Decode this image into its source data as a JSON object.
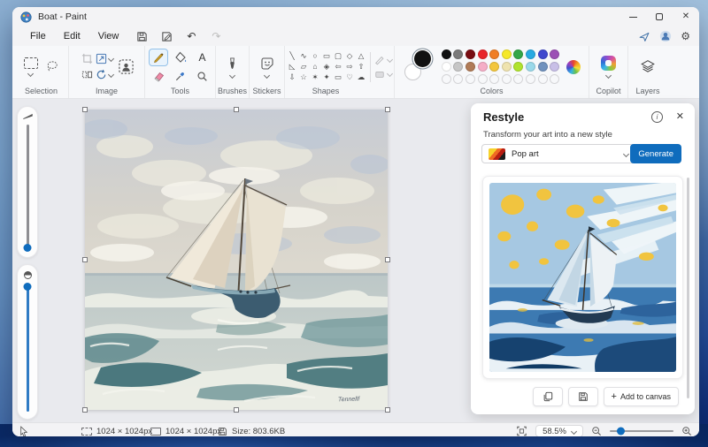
{
  "accent": "#0f6cbd",
  "window": {
    "title": "Boat - Paint"
  },
  "icons": {
    "close": "✕",
    "undo": "↶",
    "redo": "↷",
    "gear": "⚙",
    "info": "i",
    "plus": "+",
    "text_tool": "A"
  },
  "menubar": {
    "items": [
      "File",
      "Edit",
      "View"
    ]
  },
  "ribbon": {
    "groups": [
      "Selection",
      "Image",
      "Tools",
      "Brushes",
      "Stickers",
      "Shapes",
      "Colors",
      "Copilot",
      "Layers"
    ],
    "shapes": [
      "╲",
      "∿",
      "○",
      "▭",
      "▢",
      "◇",
      "△",
      "◺",
      "▱",
      "⌂",
      "◈",
      "⇦",
      "⇨",
      "⇧",
      "⇩",
      "☆",
      "✶",
      "✦",
      "▭",
      "♡",
      "☁"
    ],
    "color1": "#111111",
    "color2": "#ffffff",
    "palette_row1": [
      "#111111",
      "#7b7b7b",
      "#790c12",
      "#e8252b",
      "#f07e26",
      "#f5e829",
      "#33a648",
      "#28aae2",
      "#4048ce",
      "#9c4fb5"
    ],
    "palette_row2": [
      "#ffffff",
      "#c6c6c6",
      "#b07b57",
      "#f5aec7",
      "#f3c63e",
      "#efe3af",
      "#b0e32e",
      "#9ad9ea",
      "#7092be",
      "#c8bfe7"
    ],
    "palette_row3": [
      "",
      "",
      "",
      "",
      "",
      "",
      "",
      "",
      "",
      ""
    ]
  },
  "restyle": {
    "title": "Restyle",
    "subtitle": "Transform your art into a new style",
    "style": "Pop art",
    "generate": "Generate",
    "add_to_canvas": "Add to canvas"
  },
  "canvas": {
    "signature": "Tennellf"
  },
  "statusbar": {
    "selection_size": "1024 × 1024px",
    "canvas_size": "1024 × 1024px",
    "file_size": "Size: 803.6KB",
    "zoom": "58.5%"
  }
}
